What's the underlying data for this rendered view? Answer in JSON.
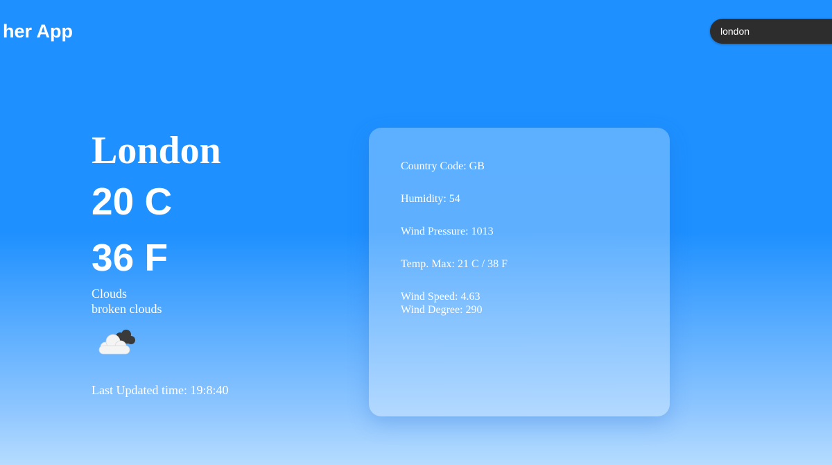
{
  "header": {
    "title": "her App"
  },
  "search": {
    "value": "london"
  },
  "weather": {
    "city": "London",
    "temp_c": "20 C",
    "temp_f": "36 F",
    "condition": "Clouds",
    "description": "broken clouds",
    "icon": "broken-clouds-icon",
    "last_updated": "Last Updated time: 19:8:40"
  },
  "details": {
    "country_code": "Country Code: GB",
    "humidity": "Humidity: 54",
    "wind_pressure": "Wind Pressure: 1013",
    "temp_max": "Temp. Max: 21 C / 38 F",
    "wind_speed": "Wind Speed: 4.63",
    "wind_degree": "Wind Degree: 290"
  },
  "colors": {
    "background_top": "#1e90ff",
    "background_bottom": "#b6dcff",
    "search_bg": "#2d2d2d",
    "text": "#ffffff"
  }
}
